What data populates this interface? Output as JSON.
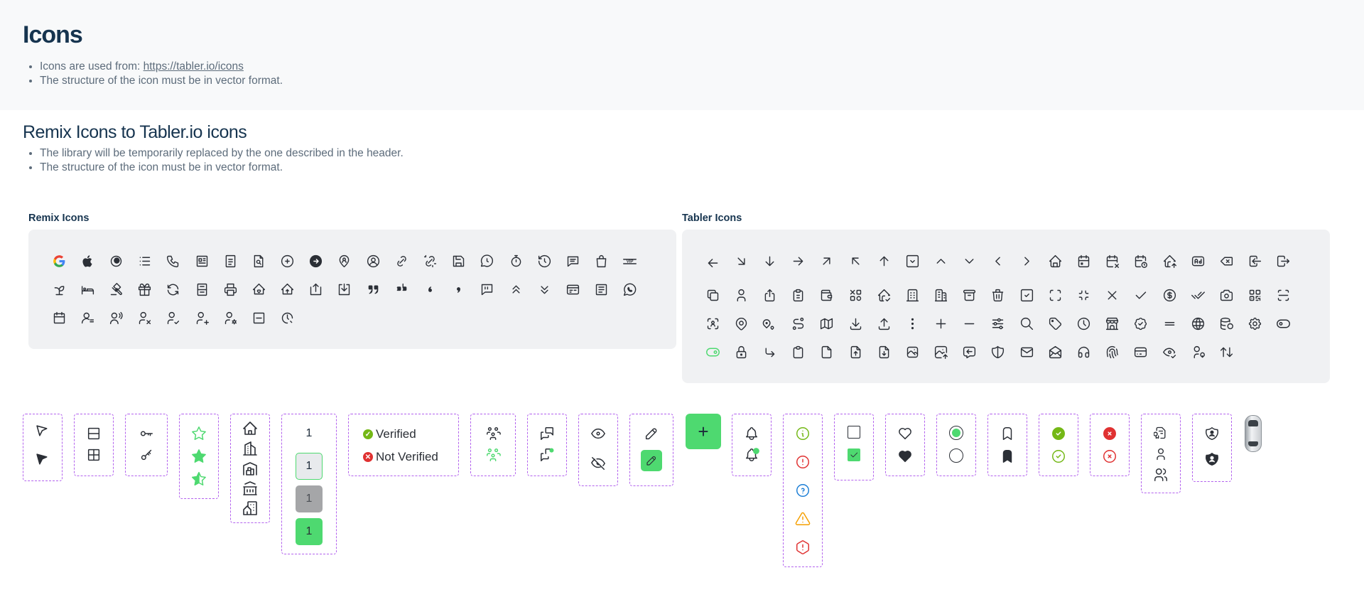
{
  "hero": {
    "title": "Icons",
    "note1_prefix": "Icons are used from: ",
    "note1_link": "https://tabler.io/icons",
    "note2": "The structure of the icon must be in vector format."
  },
  "section": {
    "title": "Remix Icons to Tabler.io icons",
    "note1": "The library will be temporarily replaced by the one described in the header.",
    "note2": "The structure of the icon must be in vector format."
  },
  "panels": {
    "remix_label": "Remix Icons",
    "tabler_label": "Tabler Icons"
  },
  "numbers": [
    "1",
    "1",
    "1",
    "1"
  ],
  "verify": {
    "verified": "Verified",
    "not_verified": "Not Verified"
  },
  "fab_symbol": "+",
  "colors": {
    "accent_green": "#4ed970",
    "dash_purple": "#b362ee",
    "error_red": "#e03131",
    "info_green": "#74b816",
    "help_blue": "#1c7ed6",
    "warn_orange": "#f59f00",
    "panel_bg": "#f0f1f3"
  }
}
